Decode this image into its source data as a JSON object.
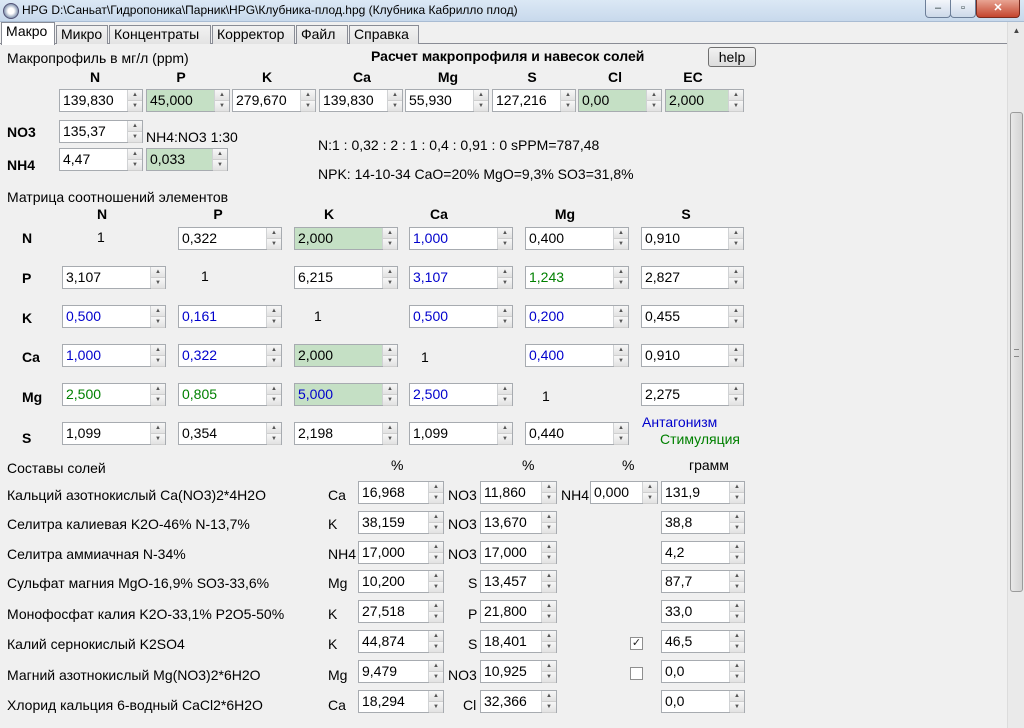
{
  "window": {
    "title": "HPG D:\\Саньат\\Гидропоника\\Парник\\HPG\\Клубника-плод.hpg (Клубника Кабрилло плод)",
    "min": "–",
    "max": "▫",
    "close": "✕"
  },
  "tabs": [
    "Макро",
    "Микро",
    "Концентраты",
    "Корректор",
    "Файл",
    "Справка"
  ],
  "macro": {
    "title": "Макропрофиль в мг/л (ppm)",
    "calc_title": "Расчет макропрофиля и навесок солей",
    "help": "help",
    "headers": [
      "N",
      "P",
      "K",
      "Ca",
      "Mg",
      "S",
      "Cl",
      "EC"
    ],
    "values": [
      "139,830",
      "45,000",
      "279,670",
      "139,830",
      "55,930",
      "127,216",
      "0,00",
      "2,000"
    ]
  },
  "nitro": {
    "no3_label": "NO3",
    "no3_value": "135,37",
    "nh4_label": "NH4",
    "nh4_value": "4,47",
    "ratio_label": "NH4:NO3 1:30",
    "ratio_value": "0,033"
  },
  "info": {
    "line1": "N:1 : 0,32 : 2 : 1 : 0,4 : 0,91 : 0 sPPM=787,48",
    "line2": "NPK: 14-10-34 CaO=20% MgO=9,3% SO3=31,8%"
  },
  "matrix": {
    "title": "Матрица соотношений элементов",
    "col_headers": [
      "N",
      "P",
      "K",
      "Ca",
      "Mg",
      "S"
    ],
    "rows": [
      {
        "label": "N",
        "cells": [
          "1",
          "0,322",
          "2,000",
          "1,000",
          "0,400",
          "0,910"
        ]
      },
      {
        "label": "P",
        "cells": [
          "3,107",
          "1",
          "6,215",
          "3,107",
          "1,243",
          "2,827"
        ]
      },
      {
        "label": "K",
        "cells": [
          "0,500",
          "0,161",
          "1",
          "0,500",
          "0,200",
          "0,455"
        ]
      },
      {
        "label": "Ca",
        "cells": [
          "1,000",
          "0,322",
          "2,000",
          "1",
          "0,400",
          "0,910"
        ]
      },
      {
        "label": "Mg",
        "cells": [
          "2,500",
          "0,805",
          "5,000",
          "2,500",
          "1",
          "2,275"
        ]
      },
      {
        "label": "S",
        "cells": [
          "1,099",
          "0,354",
          "2,198",
          "1,099",
          "0,440",
          "1"
        ]
      }
    ],
    "legend_antagonism": "Антагонизм",
    "legend_stimulation": "Стимуляция"
  },
  "salts": {
    "title": "Составы солей",
    "pct1": "%",
    "pct2": "%",
    "pct3": "%",
    "gram": "грамм",
    "rows": [
      {
        "name": "Кальций азотнокислый Ca(NO3)2*4H2O",
        "el1": "Ca",
        "v1": "16,968",
        "el2": "NO3",
        "v2": "11,860",
        "el3": "NH4",
        "v3": "0,000",
        "grams": "131,9"
      },
      {
        "name": "Селитра калиевая K2O-46% N-13,7%",
        "el1": "K",
        "v1": "38,159",
        "el2": "NO3",
        "v2": "13,670",
        "grams": "38,8"
      },
      {
        "name": "Селитра аммиачная N-34%",
        "el1": "NH4",
        "v1": "17,000",
        "el2": "NO3",
        "v2": "17,000",
        "grams": "4,2"
      },
      {
        "name": "Сульфат магния MgO-16,9% SO3-33,6%",
        "el1": "Mg",
        "v1": "10,200",
        "el2": "S",
        "v2": "13,457",
        "grams": "87,7"
      },
      {
        "name": "Монофосфат калия K2O-33,1% P2O5-50%",
        "el1": "K",
        "v1": "27,518",
        "el2": "P",
        "v2": "21,800",
        "grams": "33,0"
      },
      {
        "name": "Калий сернокислый K2SO4",
        "el1": "K",
        "v1": "44,874",
        "el2": "S",
        "v2": "18,401",
        "check": "✓",
        "grams": "46,5"
      },
      {
        "name": "Магний азотнокислый Mg(NO3)2*6H2O",
        "el1": "Mg",
        "v1": "9,479",
        "el2": "NO3",
        "v2": "10,925",
        "check": "",
        "grams": "0,0"
      },
      {
        "name": "Хлорид кальция 6-водный CaCl2*6H2O",
        "el1": "Ca",
        "v1": "18,294",
        "el2": "Cl",
        "v2": "32,366",
        "grams": "0,0"
      }
    ]
  },
  "colors": {
    "highlight": "#c5e0c5",
    "antagonism": "#0000cc",
    "stimulation": "#008000"
  }
}
